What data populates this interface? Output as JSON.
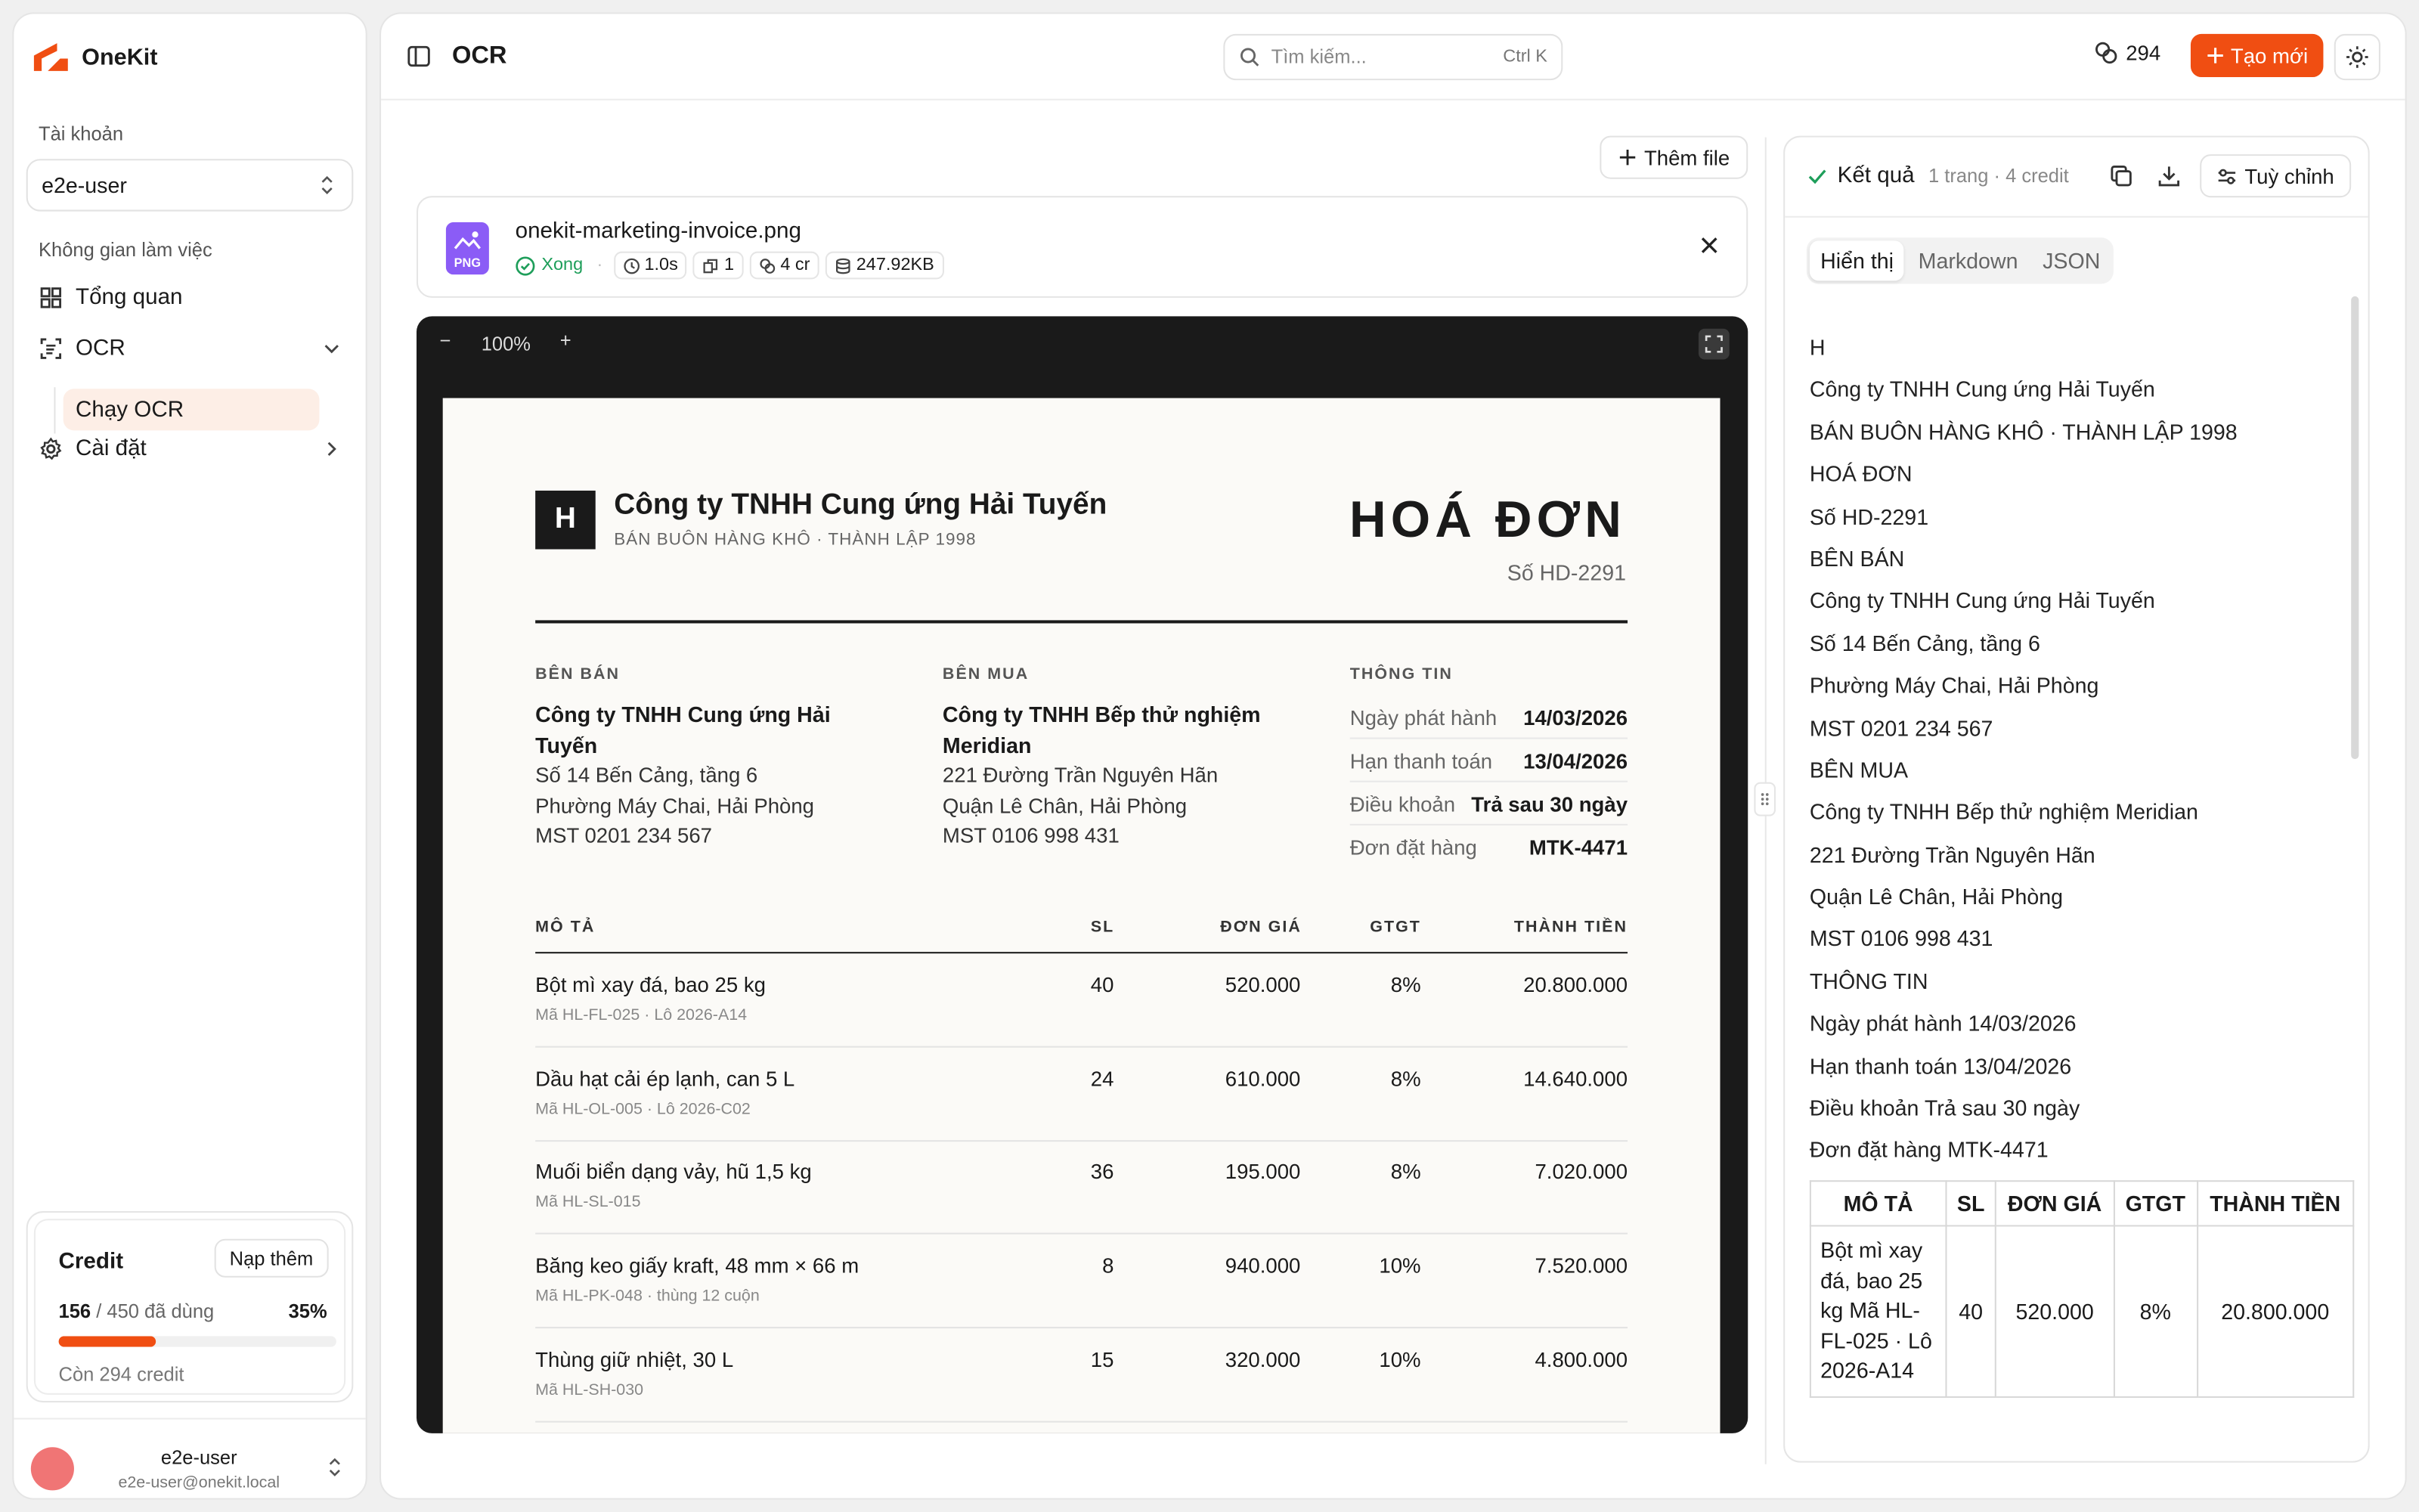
{
  "app": {
    "name": "OneKit"
  },
  "colors": {
    "accent": "#f04e12",
    "success": "#1e9e5a",
    "viewer_bg": "#1a1a1a"
  },
  "sidebar": {
    "account_label": "Tài khoản",
    "account_value": "e2e-user",
    "workspace_label": "Không gian làm việc",
    "items": [
      {
        "label": "Tổng quan",
        "icon": "dashboard-icon"
      },
      {
        "label": "OCR",
        "icon": "scan-text-icon",
        "expanded": true
      },
      {
        "label": "Chạy OCR",
        "icon": null,
        "active": true
      },
      {
        "label": "Cài đặt",
        "icon": "gear-icon"
      }
    ],
    "credit": {
      "title": "Credit",
      "topup_label": "Nạp thêm",
      "used": "156",
      "used_suffix": " / 450 đã dùng",
      "percent_label": "35%",
      "percent": 35,
      "remaining": "Còn 294 credit"
    },
    "user": {
      "name": "e2e-user",
      "email": "e2e-user@onekit.local"
    }
  },
  "topbar": {
    "title": "OCR",
    "search_placeholder": "Tìm kiếm...",
    "search_shortcut": "Ctrl K",
    "credit_count": "294",
    "create_label": "Tạo mới"
  },
  "upload": {
    "add_file_label": "Thêm file",
    "file": {
      "name": "onekit-marketing-invoice.png",
      "type_badge": "PNG",
      "status": "Xong",
      "duration": "1.0s",
      "pages": "1",
      "credits": "4 cr",
      "size": "247.92KB"
    }
  },
  "viewer": {
    "zoom": "100%",
    "minus": "−",
    "plus": "+"
  },
  "invoice": {
    "logo_letter": "H",
    "company": "Công ty TNHH Cung ứng Hải Tuyến",
    "tagline": "BÁN BUÔN HÀNG KHÔ · THÀNH LẬP 1998",
    "title": "HOÁ ĐƠN",
    "number": "Số HD-2291",
    "seller": {
      "label": "BÊN BÁN",
      "name": "Công ty TNHH Cung ứng Hải Tuyến",
      "address1": "Số 14 Bến Cảng, tầng 6",
      "address2": "Phường Máy Chai, Hải Phòng",
      "tax": "MST 0201 234 567"
    },
    "buyer": {
      "label": "BÊN MUA",
      "name": "Công ty TNHH Bếp thử nghiệm Meridian",
      "address1": "221 Đường Trần Nguyên Hãn",
      "address2": "Quận Lê Chân, Hải Phòng",
      "tax": "MST 0106 998 431"
    },
    "info": {
      "label": "THÔNG TIN",
      "rows": [
        {
          "k": "Ngày phát hành",
          "v": "14/03/2026"
        },
        {
          "k": "Hạn thanh toán",
          "v": "13/04/2026"
        },
        {
          "k": "Điều khoản",
          "v": "Trả sau 30 ngày"
        },
        {
          "k": "Đơn đặt hàng",
          "v": "MTK-4471"
        }
      ]
    },
    "columns": {
      "desc": "MÔ TẢ",
      "qty": "SL",
      "price": "ĐƠN GIÁ",
      "vat": "GTGT",
      "amount": "THÀNH TIỀN"
    },
    "items": [
      {
        "desc": "Bột mì xay đá, bao 25 kg",
        "code": "Mã HL-FL-025 · Lô 2026-A14",
        "qty": "40",
        "price": "520.000",
        "vat": "8%",
        "amount": "20.800.000"
      },
      {
        "desc": "Dầu hạt cải ép lạnh, can 5 L",
        "code": "Mã HL-OL-005 · Lô 2026-C02",
        "qty": "24",
        "price": "610.000",
        "vat": "8%",
        "amount": "14.640.000"
      },
      {
        "desc": "Muối biển dạng vảy, hũ 1,5 kg",
        "code": "Mã HL-SL-015",
        "qty": "36",
        "price": "195.000",
        "vat": "8%",
        "amount": "7.020.000"
      },
      {
        "desc": "Băng keo giấy kraft, 48 mm × 66 m",
        "code": "Mã HL-PK-048 · thùng 12 cuộn",
        "qty": "8",
        "price": "940.000",
        "vat": "10%",
        "amount": "7.520.000"
      },
      {
        "desc": "Thùng giữ nhiệt, 30 L",
        "code": "Mã HL-SH-030",
        "qty": "15",
        "price": "320.000",
        "vat": "10%",
        "amount": "4.800.000"
      }
    ]
  },
  "result": {
    "title": "Kết quả",
    "subtitle": "1 trang · 4 credit",
    "tune_label": "Tuỳ chỉnh",
    "tabs": [
      "Hiển thị",
      "Markdown",
      "JSON"
    ],
    "lines": [
      "H",
      "Công ty TNHH Cung ứng Hải Tuyến",
      "BÁN BUÔN HÀNG KHÔ · THÀNH LẬP 1998",
      "HOÁ ĐƠN",
      "Số HD-2291",
      "BÊN BÁN",
      "Công ty TNHH Cung ứng Hải Tuyến",
      "Số 14 Bến Cảng, tầng 6",
      "Phường Máy Chai, Hải Phòng",
      "MST 0201 234 567",
      "BÊN MUA",
      "Công ty TNHH Bếp thử nghiệm Meridian",
      "221 Đường Trần Nguyên Hãn",
      "Quận Lê Chân, Hải Phòng",
      "MST 0106 998 431",
      "THÔNG TIN",
      "Ngày phát hành 14/03/2026",
      "Hạn thanh toán 13/04/2026",
      "Điều khoản Trả sau 30 ngày",
      "Đơn đặt hàng MTK-4471"
    ],
    "table": {
      "headers": [
        "MÔ TẢ",
        "SL",
        "ĐƠN GIÁ",
        "GTGT",
        "THÀNH TIỀN"
      ],
      "row1": {
        "desc": "Bột mì xay đá, bao 25 kg Mã HL-FL-025 · Lô 2026-A14",
        "qty": "40",
        "price": "520.000",
        "vat": "8%",
        "amount": "20.800.000"
      }
    }
  }
}
